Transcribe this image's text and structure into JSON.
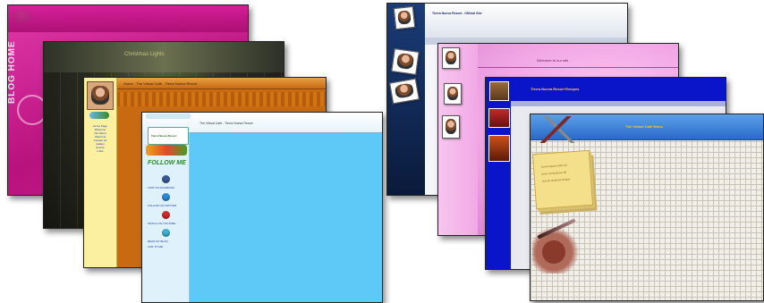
{
  "left_group": {
    "site1": {
      "vertical_text": "BLOG HOME"
    },
    "site2": {
      "header_text": "Christmas Lights"
    },
    "site3": {
      "header_text": "Home  -  The Virtual Café  -  Tierra Nueva Resort",
      "sidebar_links": [
        "Home Page",
        "Welcome",
        "Our Menu",
        "About Us",
        "Contact Us",
        "Gallery",
        "Events",
        "Links"
      ]
    },
    "site4": {
      "header_text": "The Virtual Café  -  Tierra Nueva Resort",
      "banner_text": "Tierra Nueva Resort",
      "follow_text": "FOLLOW ME",
      "nav_links": [
        "VISIT ON FACEBOOK",
        "FOLLOW ON TWITTER",
        "WATCH ON YOUTUBE",
        "READ MY BLOG",
        "LINK TO ME"
      ]
    }
  },
  "right_group": {
    "site5": {
      "header_text": "Tierra Nueva Resort - Official Site"
    },
    "site6": {
      "header_text": "Welcome to our site"
    },
    "site7": {
      "header_text": "Tierra Nueva Resort Recipes"
    },
    "site8": {
      "header_text": "The Virtual Café Menu",
      "note_lines": [
        "Lorem ipsum dolor sit",
        "amet consectetur elit",
        "sed do eiusmod tempor"
      ]
    }
  },
  "colors": {
    "magenta": "#c21a8a",
    "night": "#1b1d19",
    "orange": "#c86a12",
    "sky": "#5ec9f6",
    "navy": "#10234a",
    "pink": "#f2a8e6",
    "blue": "#0a14c8",
    "grid": "#f2efe8"
  }
}
